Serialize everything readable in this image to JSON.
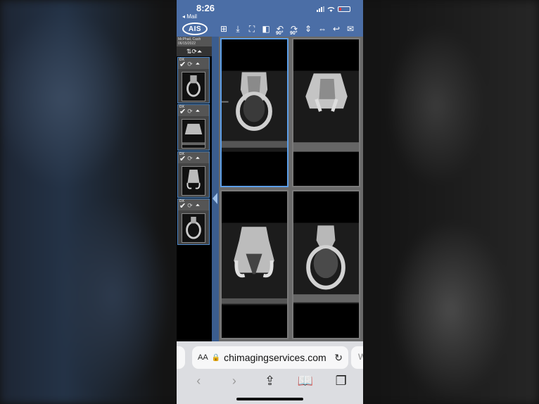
{
  "status_bar": {
    "time": "8:26",
    "back_label": "◂ Mail"
  },
  "toolbar": {
    "logo": "AIS",
    "tools": [
      {
        "name": "layout-grid-icon",
        "glyph": "⊞",
        "sub": ""
      },
      {
        "name": "download-icon",
        "glyph": "⤓",
        "sub": ""
      },
      {
        "name": "fullscreen-icon",
        "glyph": "⛶",
        "sub": ""
      },
      {
        "name": "contrast-icon",
        "glyph": "◧",
        "sub": ""
      },
      {
        "name": "rotate-left-icon",
        "glyph": "↶",
        "sub": "90°"
      },
      {
        "name": "rotate-right-icon",
        "glyph": "↷",
        "sub": "90°"
      },
      {
        "name": "flip-vertical-icon",
        "glyph": "⇕",
        "sub": ""
      },
      {
        "name": "flip-horizontal-icon",
        "glyph": "⇔",
        "sub": ""
      },
      {
        "name": "undo-icon",
        "glyph": "↩",
        "sub": ""
      },
      {
        "name": "email-icon",
        "glyph": "✉",
        "sub": ""
      }
    ]
  },
  "sidebar": {
    "patient_name": "McPhail, Cash",
    "study_date": "06/15/2022",
    "sort_glyphs": "⇅⟳⏶",
    "thumbnails": [
      {
        "modality": "DX"
      },
      {
        "modality": "DX"
      },
      {
        "modality": "DX"
      },
      {
        "modality": "DX"
      }
    ]
  },
  "browser": {
    "aa_label": "AA",
    "lock_glyph": "🔒",
    "url": "chimagingservices.com",
    "reload_glyph": "↻",
    "next_tab_glyph": "W",
    "nav": {
      "back": "‹",
      "forward": "›",
      "share": "⇪",
      "bookmarks": "📖",
      "tabs": "❐"
    }
  },
  "colors": {
    "accent": "#4b6ea6",
    "active_border": "#5c9ee8",
    "thumb_border": "#4a86c8"
  }
}
